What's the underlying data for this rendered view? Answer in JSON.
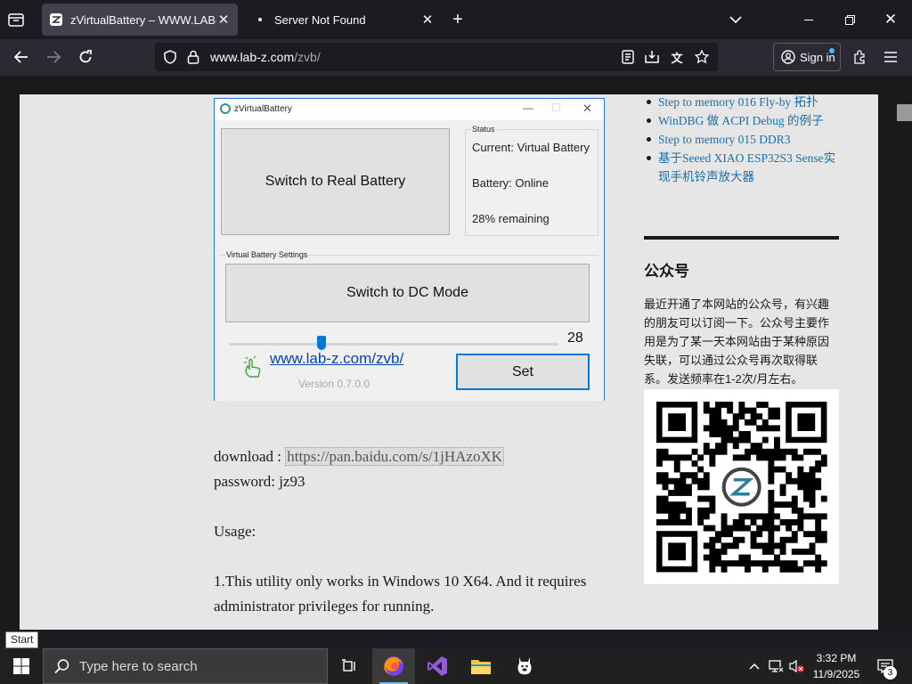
{
  "browser": {
    "tabs": [
      {
        "title": "zVirtualBattery – WWW.LAB-Z.C",
        "active": true
      },
      {
        "title": "Server Not Found",
        "active": false
      }
    ],
    "url_host": "www.lab-z.com",
    "url_path": "/zvb/",
    "sign_in_label": "Sign in"
  },
  "app_window": {
    "title": "zVirtualBattery",
    "switch_battery_label": "Switch to Real Battery",
    "status_legend": "Status",
    "status_current": "Current: Virtual Battery",
    "status_battery": "Battery: Online",
    "status_remaining": "28% remaining",
    "settings_legend": "Virtual Battery Settings",
    "switch_mode_label": "Switch to DC Mode",
    "slider_value": "28",
    "slider_level": 28,
    "link": "www.lab-z.com/zvb/",
    "version": "Version 0.7.0.0",
    "set_label": "Set"
  },
  "article": {
    "download_label": "download :",
    "download_link": "https://pan.baidu.com/s/1jHAzoXK",
    "password_line": "password: jz93",
    "usage_heading": "Usage:",
    "usage_line1": "1.This utility only works in Windows 10 X64. And it requires",
    "usage_line2": "administrator privileges for running."
  },
  "sidebar": {
    "posts": [
      {
        "text": "Step to memory 016 Fly-by 拓扑"
      },
      {
        "text": "WinDBG 做 ACPI Debug 的例子"
      },
      {
        "text": "Step to memory 015 DDR3"
      },
      {
        "text": "基于Seeed XIAO ESP32S3 Sense实现手机铃声放大器"
      }
    ],
    "heading": "公众号",
    "paragraph": "最近开通了本网站的公众号，有兴趣的朋友可以订阅一下。公众号主要作用是为了某一天本网站由于某种原因失联，可以通过公众号再次取得联系。发送频率在1-2次/月左右。"
  },
  "tooltip": "Start",
  "taskbar": {
    "search_placeholder": "Type here to search",
    "time": "3:32 PM",
    "date": "11/9/2025",
    "notification_count": "3"
  },
  "colors": {
    "link_blue": "#1a6fa8",
    "taskbar_bg": "#202020",
    "accent": "#0078d7"
  }
}
